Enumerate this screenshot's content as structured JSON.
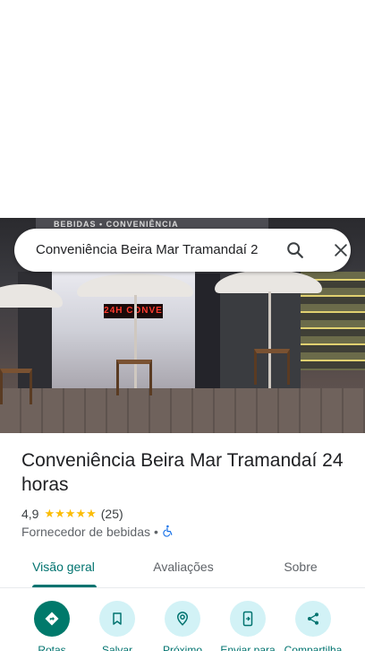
{
  "search": {
    "value": "Conveniência Beira Mar Tramandaí 2",
    "search_icon": "search-icon",
    "close_icon": "close-icon"
  },
  "photo": {
    "sign_text": "BEBIDAS • CONVENIÊNCIA",
    "led_text": "24H CONVE"
  },
  "place": {
    "title": "Conveniência Beira Mar Tramandaí 24 horas",
    "rating": "4,9",
    "stars": 5,
    "review_count": "(25)",
    "category": "Fornecedor de bebidas",
    "separator": "•",
    "accessibility_icon": "wheelchair-icon"
  },
  "tabs": [
    {
      "label": "Visão geral",
      "active": true
    },
    {
      "label": "Avaliações",
      "active": false
    },
    {
      "label": "Sobre",
      "active": false
    }
  ],
  "actions": [
    {
      "label": "Rotas",
      "icon": "directions-icon"
    },
    {
      "label": "Salvar",
      "icon": "bookmark-icon"
    },
    {
      "label": "Próximo",
      "icon": "nearby-icon"
    },
    {
      "label": "Enviar para",
      "icon": "send-to-phone-icon"
    },
    {
      "label": "Compartilha",
      "icon": "share-icon"
    }
  ],
  "colors": {
    "accent": "#00736f",
    "accent_dark": "#00796b",
    "chip_bg": "#d2f2f6",
    "star": "#fbbc04"
  }
}
